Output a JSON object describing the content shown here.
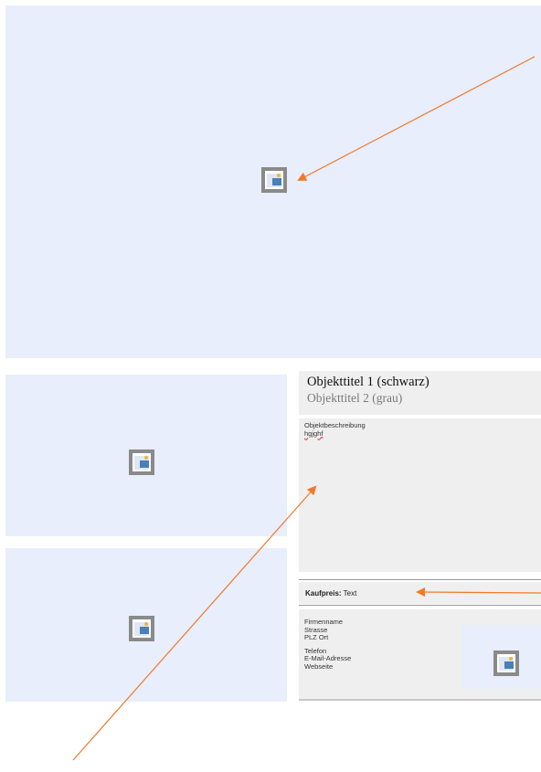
{
  "listing": {
    "title_primary": "Objekttitel 1 (schwarz)",
    "title_secondary": "Objekttitel 2 (grau)",
    "description_heading": "Objektbeschreibung",
    "description_text": "hgjghf",
    "price_label": "Kaufpreis:",
    "price_value": "Text",
    "contact": {
      "company": "Firmenname",
      "street": "Strasse",
      "city": "PLZ Ort",
      "phone": "Telefon",
      "email": "E-Mail-Adresse",
      "website": "Webseite"
    }
  },
  "colors": {
    "placeholder_bg": "#e8eefb",
    "panel_bg": "#efefef",
    "arrow": "#f07a2a"
  },
  "icons": [
    "picture-placeholder-icon"
  ]
}
